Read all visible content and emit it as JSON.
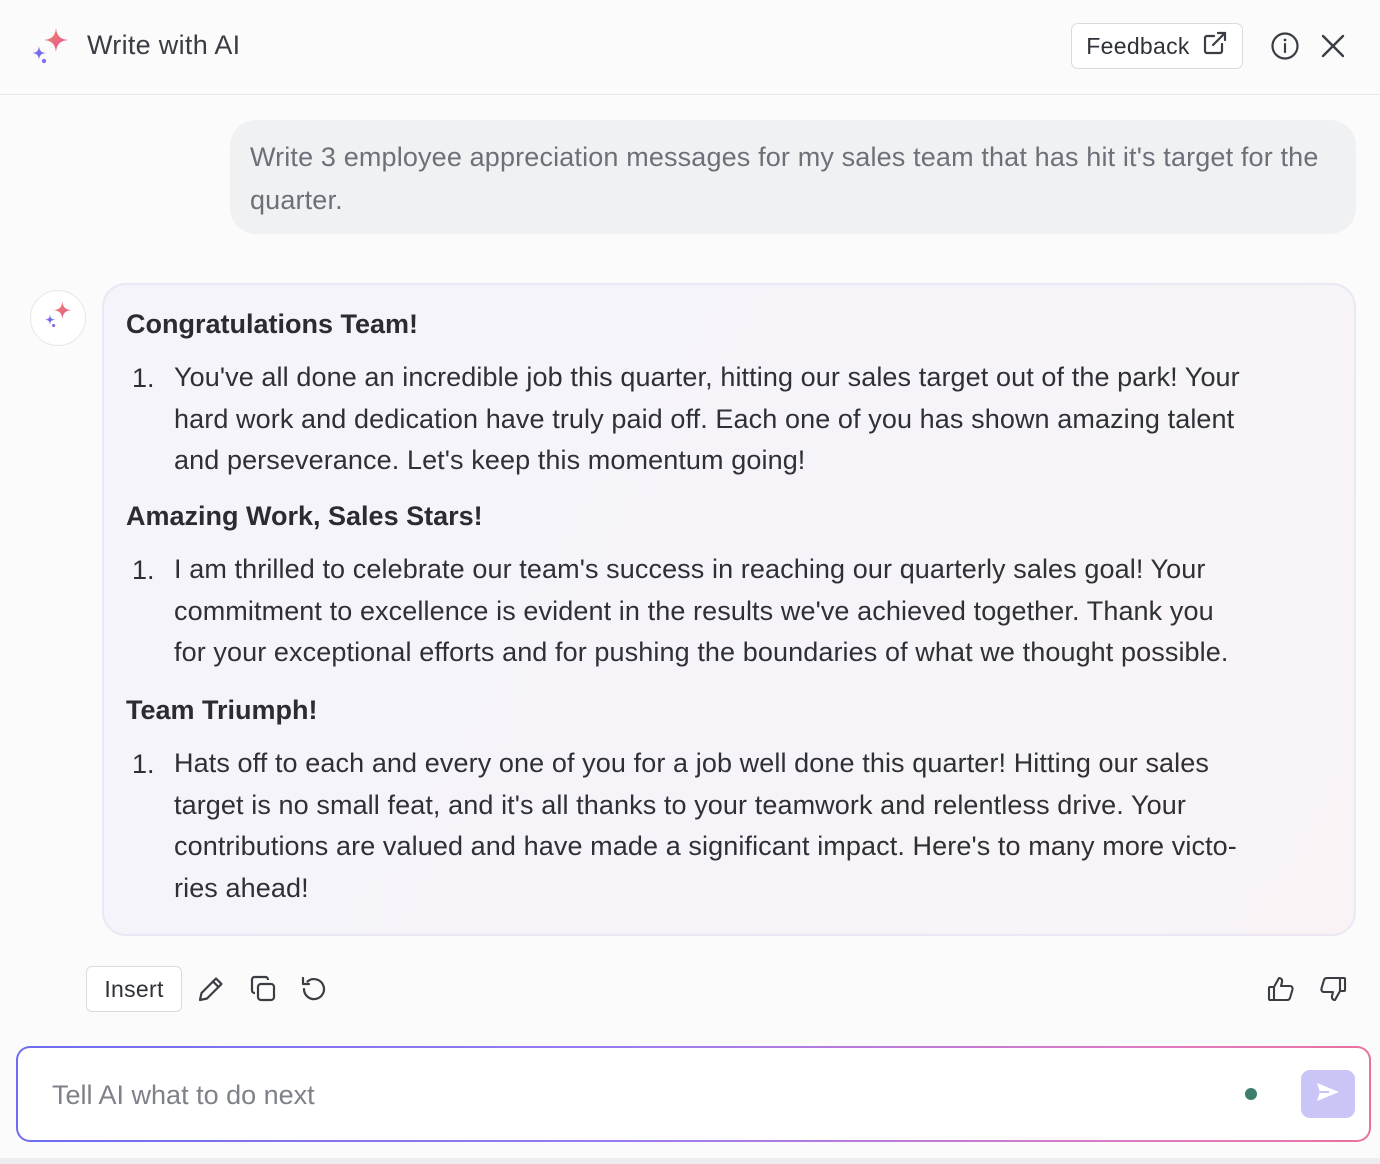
{
  "header": {
    "title": "Write with AI",
    "feedback_label": "Feedback",
    "icons": [
      "sparkle-icon",
      "external-link-icon",
      "info-icon",
      "close-icon"
    ]
  },
  "conversation": {
    "user_prompt": "Write 3 employee appreciation messages for my sales team that has hit it's target for the quarter.",
    "ai_response": {
      "sections": [
        {
          "title": "Congratulations Team!",
          "number": "1.",
          "lines": [
            "You've all done an incredible job this quarter, hitting our sales target out of the park! Your",
            "hard work and dedication have truly paid off. Each one of you has shown amazing talent",
            "and perseverance. Let's keep this momentum going!"
          ]
        },
        {
          "title": "Amazing Work, Sales Stars!",
          "number": "1.",
          "lines": [
            "I am thrilled to celebrate our team's success in reaching our quarterly sales goal! Your",
            "commitment to excellence is evident in the results we've achieved together. Thank you",
            "for your exceptional efforts and for pushing the boundaries of what we thought possible."
          ]
        },
        {
          "title": "Team Triumph!",
          "number": "1.",
          "lines": [
            "Hats off to each and every one of you for a job well done this quarter! Hitting our sales",
            "target is no small feat, and it's all thanks to your teamwork and relentless drive. Your",
            "contributions are valued and have made a significant impact. Here's to many more victo-",
            "ries ahead!"
          ]
        }
      ]
    }
  },
  "actions": {
    "insert_label": "Insert",
    "icons": [
      "edit-pencil-icon",
      "copy-icon",
      "regenerate-icon",
      "thumbs-up-icon",
      "thumbs-down-icon"
    ]
  },
  "composer": {
    "placeholder": "Tell AI what to do next",
    "value": ""
  },
  "colors": {
    "accent_purple": "#7b6cf0",
    "accent_pink": "#e8729e",
    "send_button": "#c9c6f7",
    "status_dot": "#3f7e6e"
  }
}
